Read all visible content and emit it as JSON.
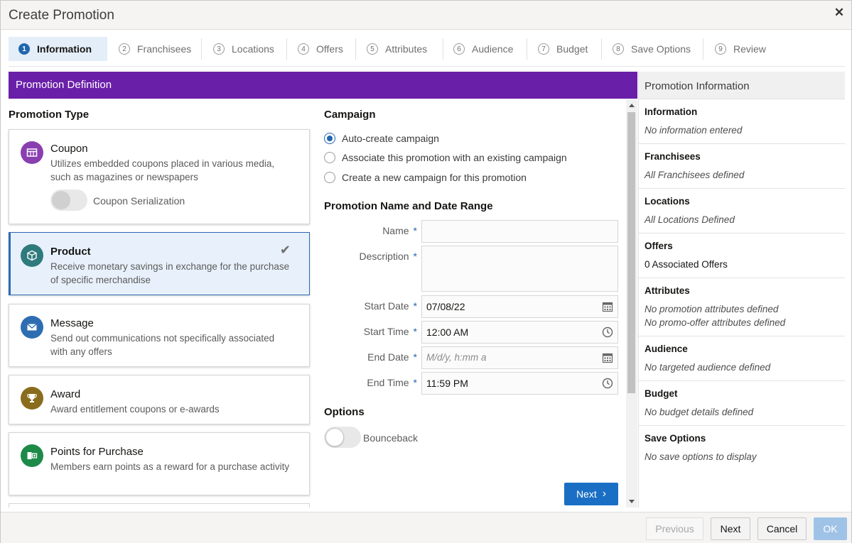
{
  "dialog": {
    "title": "Create Promotion"
  },
  "train": [
    {
      "num": "1",
      "label": "Information"
    },
    {
      "num": "2",
      "label": "Franchisees"
    },
    {
      "num": "3",
      "label": "Locations"
    },
    {
      "num": "4",
      "label": "Offers"
    },
    {
      "num": "5",
      "label": "Attributes"
    },
    {
      "num": "6",
      "label": "Audience"
    },
    {
      "num": "7",
      "label": "Budget"
    },
    {
      "num": "8",
      "label": "Save Options"
    },
    {
      "num": "9",
      "label": "Review"
    }
  ],
  "section_bar": "Promotion Definition",
  "promotion_type": {
    "heading": "Promotion Type",
    "cards": [
      {
        "title": "Coupon",
        "desc": "Utilizes embedded coupons placed in various media, such as magazines or newspapers",
        "icon": "coupon-icon",
        "color": "#8a3fb0"
      },
      {
        "title": "Product",
        "desc": "Receive monetary savings in exchange for the purchase of specific merchandise",
        "icon": "product-icon",
        "color": "#2f7a7c"
      },
      {
        "title": "Message",
        "desc": "Send out communications not specifically associated with any offers",
        "icon": "message-icon",
        "color": "#2e6db2"
      },
      {
        "title": "Award",
        "desc": "Award entitlement coupons or e-awards",
        "icon": "trophy-icon",
        "color": "#8a6c1e"
      },
      {
        "title": "Points for Purchase",
        "desc": "Members earn points as a reward for a purchase activity",
        "icon": "points-icon",
        "color": "#1e8a4a"
      }
    ],
    "coupon_serialization_label": "Coupon Serialization"
  },
  "campaign": {
    "heading": "Campaign",
    "options": [
      "Auto-create campaign",
      "Associate this promotion with an existing campaign",
      "Create a new campaign for this promotion"
    ]
  },
  "name_date": {
    "heading": "Promotion Name and Date Range",
    "name_label": "Name",
    "name_value": "",
    "description_label": "Description",
    "description_value": "",
    "start_date_label": "Start Date",
    "start_date_value": "07/08/22",
    "start_time_label": "Start Time",
    "start_time_value": "12:00 AM",
    "end_date_label": "End Date",
    "end_date_placeholder": "M/d/y, h:mm a",
    "end_time_label": "End Time",
    "end_time_value": "11:59 PM",
    "required_mark": "*"
  },
  "options": {
    "heading": "Options",
    "bounceback_label": "Bounceback"
  },
  "next_inline": "Next",
  "info_panel": {
    "heading": "Promotion Information",
    "sections": [
      {
        "title": "Information",
        "value": "No information entered"
      },
      {
        "title": "Franchisees",
        "value": "All Franchisees defined"
      },
      {
        "title": "Locations",
        "value": "All Locations Defined"
      },
      {
        "title": "Offers",
        "value": "0 Associated Offers"
      },
      {
        "title": "Attributes",
        "value": "No promotion attributes defined",
        "value2": "No promo-offer attributes defined"
      },
      {
        "title": "Audience",
        "value": "No targeted audience defined"
      },
      {
        "title": "Budget",
        "value": "No budget details defined"
      },
      {
        "title": "Save Options",
        "value": "No save options to display"
      }
    ]
  },
  "footer": {
    "previous": "Previous",
    "next": "Next",
    "cancel": "Cancel",
    "ok": "OK"
  }
}
